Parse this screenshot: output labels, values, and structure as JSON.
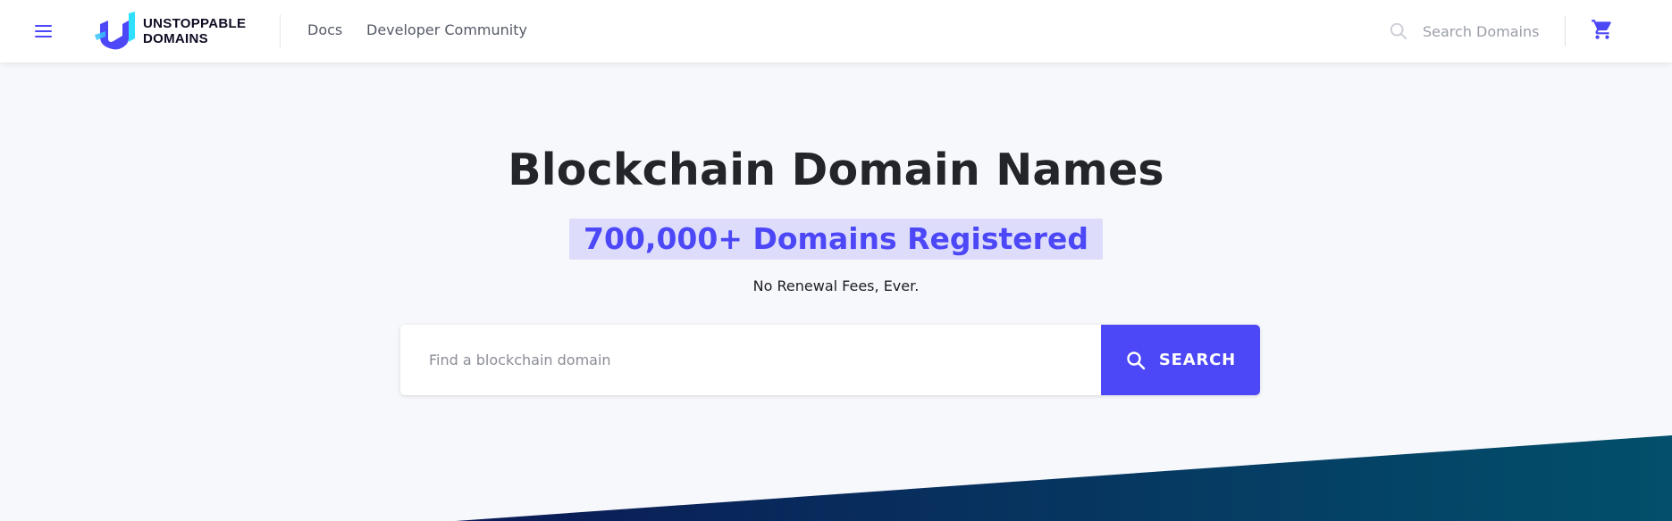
{
  "header": {
    "logo": {
      "line1": "UNSTOPPABLE",
      "line2": "DOMAINS"
    },
    "nav": [
      {
        "label": "Docs"
      },
      {
        "label": "Developer Community"
      }
    ],
    "search": {
      "placeholder": "Search Domains"
    }
  },
  "hero": {
    "title": "Blockchain Domain Names",
    "badge": "700,000+ Domains Registered",
    "subtitle": "No Renewal Fees, Ever.",
    "search": {
      "placeholder": "Find a blockchain domain",
      "button_label": "SEARCH"
    }
  },
  "colors": {
    "accent": "#4c47f7",
    "badge_bg": "#dedcfb",
    "background": "#f7f8fc",
    "wave_start": "#0b1a55",
    "wave_end": "#02506b"
  },
  "icons": [
    "menu-icon",
    "logo-icon",
    "search-icon",
    "cart-icon"
  ]
}
